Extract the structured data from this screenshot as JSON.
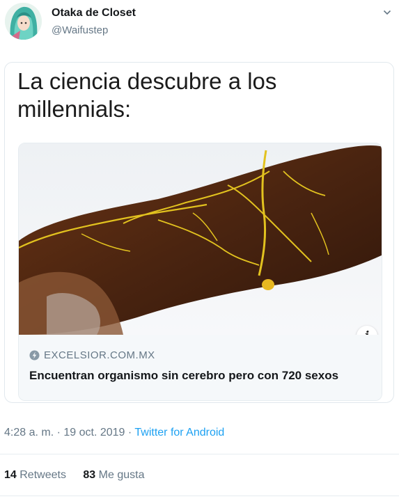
{
  "tweet": {
    "author": {
      "display_name": "Otaka de Closet",
      "handle": "@Waifustep"
    },
    "meme_text": "La ciencia descubre a los millennials:",
    "link_card": {
      "domain": "EXCELSIOR.COM.MX",
      "title": "Encuentran organismo sin cerebro pero con 720 sexos",
      "info_label": "i"
    },
    "timestamp": "4:28 a. m. · 19 oct. 2019",
    "separator": " · ",
    "source": "Twitter for Android",
    "stats": {
      "retweets_count": "14",
      "retweets_label": "Retweets",
      "likes_count": "83",
      "likes_label": "Me gusta"
    }
  },
  "colors": {
    "link_blue": "#1da1f2",
    "secondary_text": "#657786",
    "slime_yellow": "#e2c21f"
  },
  "icons": {
    "menu": "chevron-down-icon",
    "link": "link-icon",
    "info": "info-icon"
  }
}
